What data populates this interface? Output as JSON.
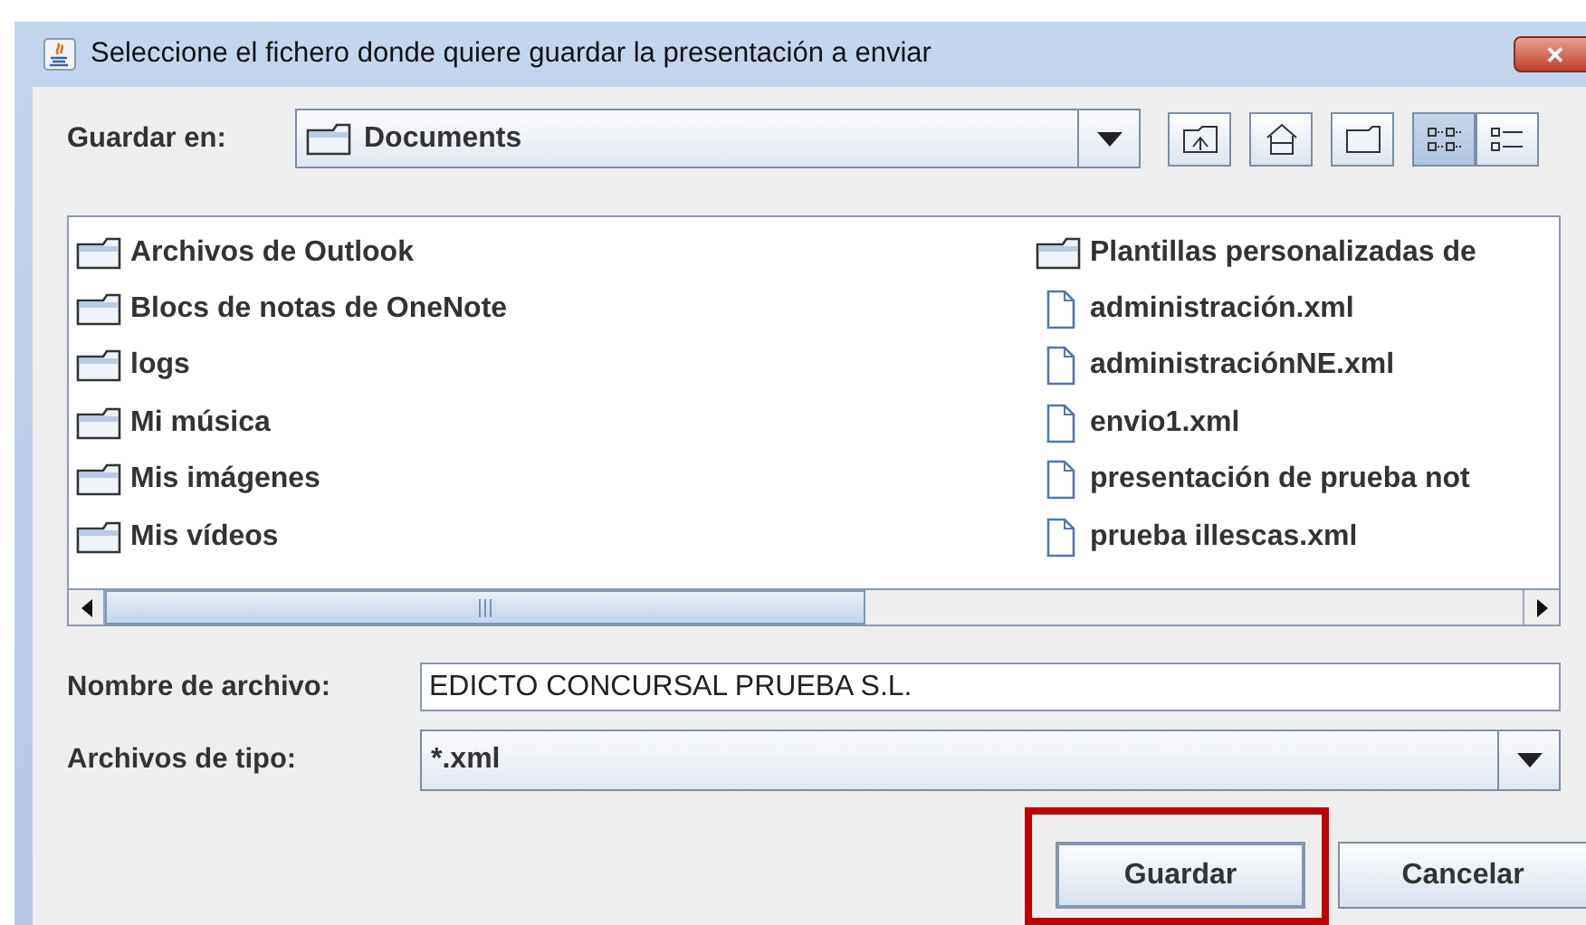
{
  "window": {
    "title": "Seleccione el fichero donde quiere guardar la presentación a enviar",
    "close_label": "✕"
  },
  "save_in": {
    "label": "Guardar en:",
    "value": "Documents"
  },
  "toolbar": [
    {
      "kind": "up"
    },
    {
      "kind": "home"
    },
    {
      "kind": "new_folder"
    },
    {
      "kind": "list",
      "selected": true
    },
    {
      "kind": "details",
      "selected": false
    }
  ],
  "files": [
    {
      "name": "Archivos de Outlook",
      "kind": "folder"
    },
    {
      "name": "Blocs de notas de OneNote",
      "kind": "folder"
    },
    {
      "name": "logs",
      "kind": "folder"
    },
    {
      "name": "Mi música",
      "kind": "folder"
    },
    {
      "name": "Mis imágenes",
      "kind": "folder"
    },
    {
      "name": "Mis vídeos",
      "kind": "folder"
    },
    {
      "name": "Plantillas personalizadas de",
      "kind": "folder"
    },
    {
      "name": "administración.xml",
      "kind": "file"
    },
    {
      "name": "administraciónNE.xml",
      "kind": "file"
    },
    {
      "name": "envio1.xml",
      "kind": "file"
    },
    {
      "name": "presentación de prueba not",
      "kind": "file"
    },
    {
      "name": "prueba illescas.xml",
      "kind": "file"
    }
  ],
  "file_name": {
    "label": "Nombre de archivo:",
    "value": "EDICTO CONCURSAL PRUEBA S.L."
  },
  "file_type": {
    "label": "Archivos de tipo:",
    "value": "*.xml"
  },
  "buttons": [
    {
      "label": "Guardar",
      "highlighted": true
    },
    {
      "label": "Cancelar",
      "highlighted": false
    }
  ]
}
